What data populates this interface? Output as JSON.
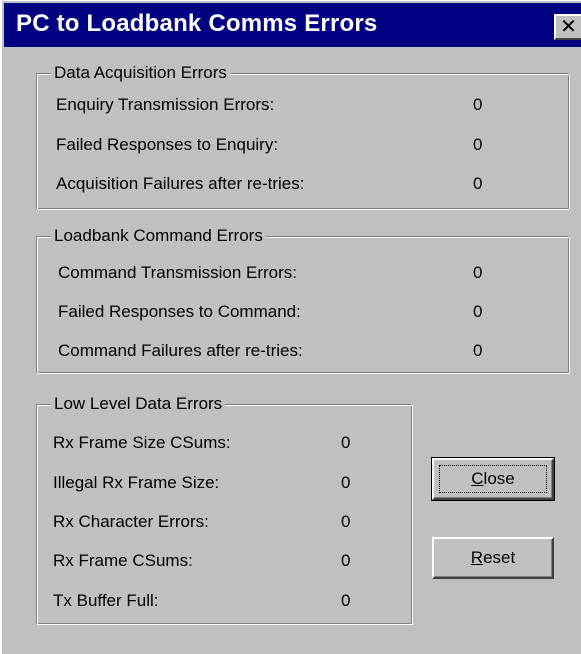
{
  "window": {
    "title": "PC to Loadbank Comms Errors",
    "close_glyph": "✕"
  },
  "groups": {
    "data_acquisition": {
      "title": "Data Acquisition Errors",
      "rows": [
        {
          "label": "Enquiry Transmission Errors:",
          "value": "0"
        },
        {
          "label": "Failed Responses to Enquiry:",
          "value": "0"
        },
        {
          "label": "Acquisition Failures after re-tries:",
          "value": "0"
        }
      ]
    },
    "loadbank_command": {
      "title": "Loadbank Command Errors",
      "rows": [
        {
          "label": "Command Transmission Errors:",
          "value": "0"
        },
        {
          "label": "Failed Responses to Command:",
          "value": "0"
        },
        {
          "label": "Command Failures after re-tries:",
          "value": "0"
        }
      ]
    },
    "low_level": {
      "title": "Low Level Data Errors",
      "rows": [
        {
          "label": "Rx Frame Size CSums:",
          "value": "0"
        },
        {
          "label": "Illegal Rx Frame Size:",
          "value": "0"
        },
        {
          "label": "Rx Character Errors:",
          "value": "0"
        },
        {
          "label": "Rx Frame CSums:",
          "value": "0"
        },
        {
          "label": "Tx Buffer Full:",
          "value": "0"
        }
      ]
    }
  },
  "buttons": {
    "close": {
      "mnemonic": "C",
      "rest": "lose"
    },
    "reset": {
      "mnemonic": "R",
      "rest": "eset"
    }
  }
}
